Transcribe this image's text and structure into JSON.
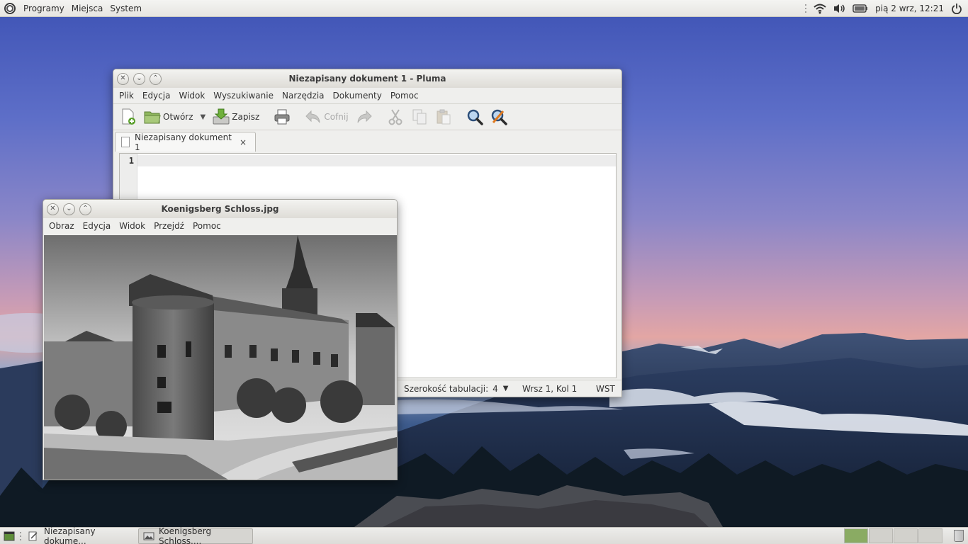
{
  "top_panel": {
    "menus": [
      "Programy",
      "Miejsca",
      "System"
    ],
    "clock": "pią  2 wrz, 12:21"
  },
  "pluma": {
    "title": "Niezapisany dokument 1 - Pluma",
    "menu": [
      "Plik",
      "Edycja",
      "Widok",
      "Wyszukiwanie",
      "Narzędzia",
      "Dokumenty",
      "Pomoc"
    ],
    "toolbar": {
      "open_label": "Otwórz",
      "save_label": "Zapisz",
      "undo_label": "Cofnij"
    },
    "tab_label": "Niezapisany dokument 1",
    "tab_close": "×",
    "line_number": "1",
    "status": {
      "tab_width_label": "Szerokość tabulacji:",
      "tab_width_value": "4",
      "position": "Wrsz 1, Kol 1",
      "mode": "WST"
    }
  },
  "viewer": {
    "title": "Koenigsberg Schloss.jpg",
    "menu": [
      "Obraz",
      "Edycja",
      "Widok",
      "Przejdź",
      "Pomoc"
    ]
  },
  "taskbar": {
    "tasks": [
      "Niezapisany dokume...",
      "Koenigsberg Schloss...."
    ]
  },
  "colors": {
    "panel": "#e6e5e1",
    "window_bg": "#efefed",
    "workspace_active": "#8aab63"
  }
}
